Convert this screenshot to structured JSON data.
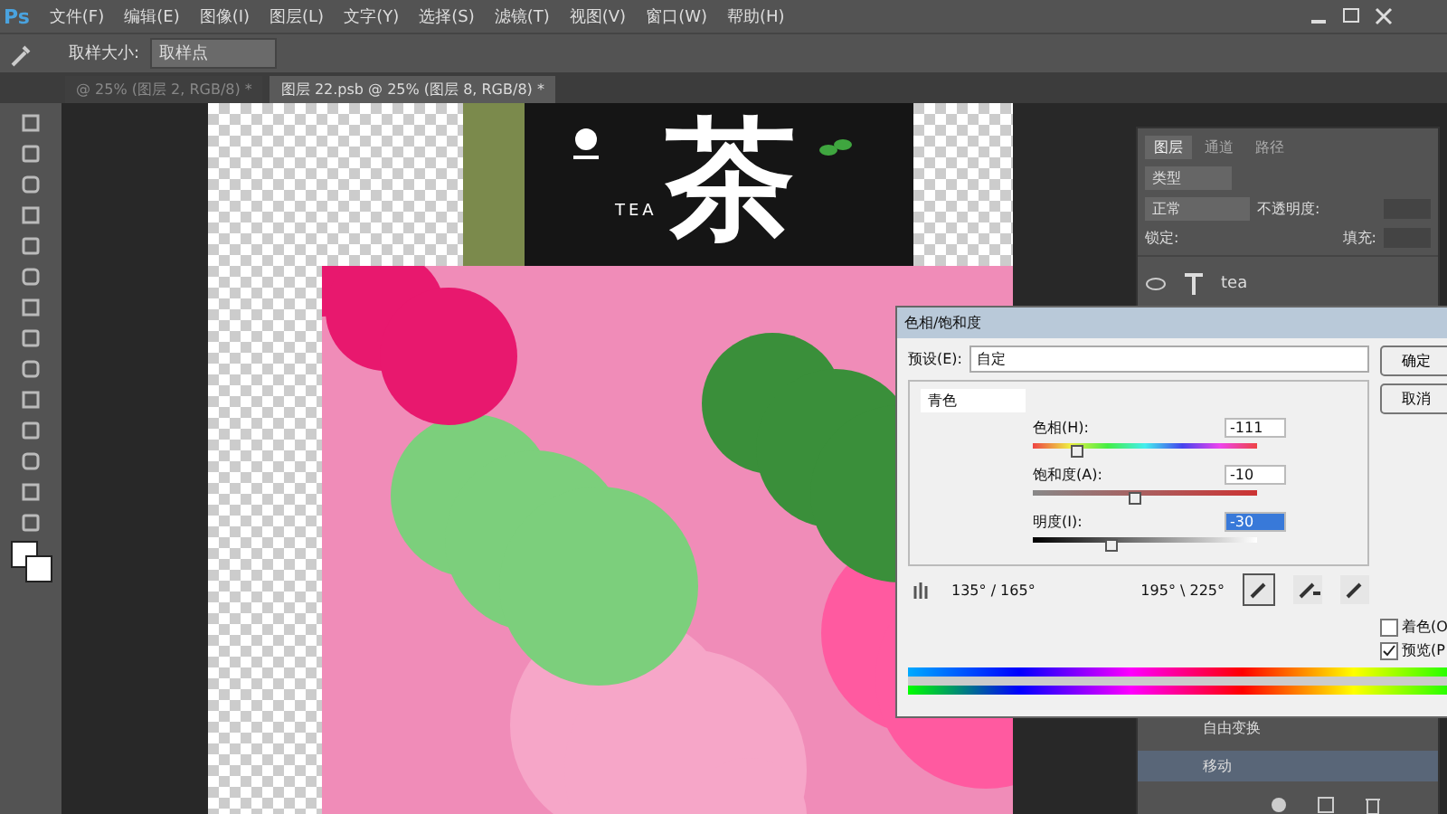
{
  "app_logo": "Ps",
  "menu": [
    "文件(F)",
    "编辑(E)",
    "图像(I)",
    "图层(L)",
    "文字(Y)",
    "选择(S)",
    "滤镜(T)",
    "视图(V)",
    "窗口(W)",
    "帮助(H)"
  ],
  "options_bar": {
    "label": "取样大小:",
    "value": "取样点"
  },
  "doc_tabs": [
    {
      "label": "@ 25% (图层 2, RGB/8) *",
      "selected": false
    },
    {
      "label": "图层 22.psb @ 25% (图层 8, RGB/8) *",
      "selected": true
    }
  ],
  "document": {
    "package_title": "茶",
    "package_subtitle": "TEA"
  },
  "layers_panel": {
    "tabs": [
      {
        "label": "图层",
        "selected": true
      },
      {
        "label": "通道",
        "selected": false
      },
      {
        "label": "路径",
        "selected": false
      }
    ],
    "filter": "类型",
    "blend_mode": "正常",
    "opacity_label": "不透明度:",
    "lock_label": "锁定:",
    "fill_label": "填充:",
    "layers": [
      {
        "name": "tea",
        "visible": true
      }
    ],
    "history": [
      {
        "name": "自由变换",
        "selected": false
      },
      {
        "name": "移动",
        "selected": true
      }
    ]
  },
  "dialog": {
    "title": "色相/饱和度",
    "preset_label": "预设(E):",
    "preset_value": "自定",
    "channel": "青色",
    "sliders": [
      {
        "label": "色相(H):",
        "value": "-111",
        "level": 0.19,
        "kind": "hue",
        "selected": false
      },
      {
        "label": "饱和度(A):",
        "value": "-10",
        "level": 0.45,
        "kind": "saturation",
        "selected": false
      },
      {
        "label": "明度(I):",
        "value": "-30",
        "level": 0.35,
        "kind": "lightness",
        "selected": true
      }
    ],
    "range_left": "135° / 165°",
    "range_right": "195° \\ 225°",
    "buttons": [
      "确定",
      "取消"
    ],
    "checkboxes": [
      {
        "label": "着色(O",
        "checked": false
      },
      {
        "label": "预览(P",
        "checked": true
      }
    ]
  }
}
